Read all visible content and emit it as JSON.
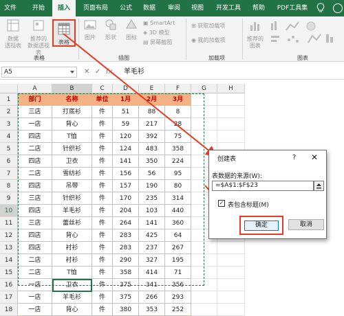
{
  "tabs": [
    "文件",
    "开始",
    "插入",
    "页面布局",
    "公式",
    "数据",
    "审阅",
    "视图",
    "开发工具",
    "帮助",
    "PDF工具集"
  ],
  "active_tab": "插入",
  "ribbon": {
    "pivot_label": [
      "数据",
      "透视表"
    ],
    "recommended_pivot_label": [
      "推荐的",
      "数据透视表"
    ],
    "table_label": "表格",
    "picture_label": "图片",
    "shapes_label": "形状",
    "icons_label": "图标",
    "smartart_label": "SmartArt",
    "model_label": "3D 模型",
    "screenshot_label": "屏幕截图",
    "get_addins_label": "获取加载项",
    "my_addins_label": "我的加载项",
    "recommended_charts_label": [
      "推荐的",
      "图表"
    ],
    "group_tables": "表格",
    "group_illustrations": "插图",
    "group_addins": "加载项",
    "group_charts": "图表"
  },
  "formula_bar": {
    "name_box": "A5",
    "cancel": "✕",
    "enter": "✓",
    "fx": "fx",
    "content": "羊毛衫"
  },
  "sheet": {
    "columns": [
      "A",
      "B",
      "C",
      "D",
      "E",
      "F",
      "G",
      "H"
    ],
    "rows": [
      [
        "部门",
        "名称",
        "单位",
        "1月",
        "2月",
        "3月"
      ],
      [
        "三店",
        "打底衫",
        "件",
        "51",
        "88",
        "8"
      ],
      [
        "一店",
        "背心",
        "件",
        "59",
        "217",
        "28"
      ],
      [
        "四店",
        "T恤",
        "件",
        "120",
        "392",
        "75"
      ],
      [
        "二店",
        "针织衫",
        "件",
        "124",
        "483",
        "358"
      ],
      [
        "四店",
        "卫衣",
        "件",
        "141",
        "350",
        "224"
      ],
      [
        "二店",
        "雪纺衫",
        "件",
        "156",
        "56",
        "95"
      ],
      [
        "四店",
        "吊带",
        "件",
        "157",
        "190",
        "80"
      ],
      [
        "三店",
        "针织衫",
        "件",
        "170",
        "235",
        "314"
      ],
      [
        "四店",
        "羊毛衫",
        "件",
        "204",
        "103",
        "440"
      ],
      [
        "三店",
        "蕾丝衫",
        "件",
        "264",
        "141",
        "360"
      ],
      [
        "四店",
        "背心",
        "件",
        "283",
        "425",
        "64"
      ],
      [
        "四店",
        "衬衫",
        "件",
        "283",
        "237",
        "267"
      ],
      [
        "二店",
        "衬衫",
        "件",
        "290",
        "327",
        "195"
      ],
      [
        "二店",
        "T恤",
        "件",
        "358",
        "414",
        "71"
      ],
      [
        "一店",
        "卫衣",
        "件",
        "375",
        "341",
        "356"
      ],
      [
        "一店",
        "羊毛衫",
        "件",
        "375",
        "266",
        "293"
      ],
      [
        "一店",
        "背心",
        "件",
        "380",
        "353",
        "252"
      ]
    ],
    "row_numbers": [
      "1",
      "2",
      "3",
      "4",
      "5",
      "6",
      "7",
      "8",
      "9",
      "10",
      "11",
      "12",
      "13",
      "14",
      "15",
      "16",
      "17",
      "18"
    ]
  },
  "dialog": {
    "title": "创建表",
    "help": "?",
    "close": "✕",
    "source_label": "表数据的来源(W):",
    "range": "=$A$1:$F$23",
    "has_headers_label": "表包含标题(M)",
    "has_headers_checked": true,
    "check_mark": "✓",
    "ok": "确定",
    "cancel": "取消"
  },
  "colors": {
    "excel_green": "#217346",
    "header_fill": "#f4b183",
    "highlight_red": "#e63b22"
  }
}
